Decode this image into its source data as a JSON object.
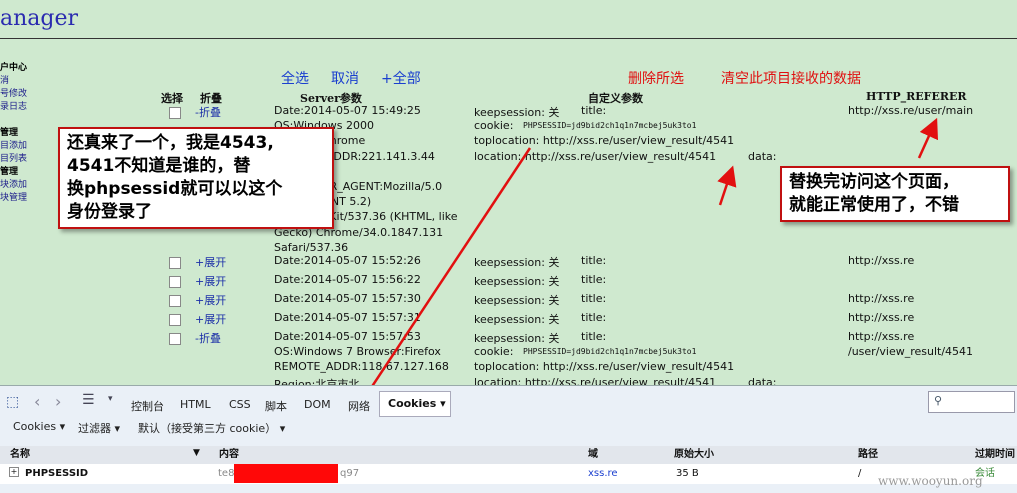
{
  "header": {
    "title": "anager"
  },
  "sidebar": {
    "items": [
      "户中心",
      "消",
      "号修改",
      "录日志",
      "管理",
      "目添加",
      "目列表",
      "管理",
      "块添加",
      "块管理"
    ]
  },
  "actions": {
    "select_all": "全选",
    "cancel": "取消",
    "plus_all": "+全部",
    "delete_selected": "删除所选",
    "clear_project": "清空此项目接收的数据"
  },
  "columns": {
    "select": "选择",
    "fold": "折叠",
    "server": "Server参数",
    "custom": "自定义参数",
    "referer": "HTTP_REFERER"
  },
  "rows": [
    {
      "fold": "-折叠",
      "server": [
        "Date:2014-05-07 15:49:25",
        "OS:Windows 2000",
        "Browser:Chrome",
        "REMOTE_ADDR:221.141.3.44",
        "",
        "HTTP_USER_AGENT:Mozilla/5.0",
        "(Windows NT 5.2)",
        "AppleWebKit/537.36 (KHTML, like",
        "Gecko) Chrome/34.0.1847.131",
        "Safari/537.36"
      ],
      "keepsession": "keepsession: 关",
      "title": "title:",
      "cookie_label": "cookie:",
      "cookie_value": "PHPSESSID=jd9bid2ch1q1n7mcbej5uk3to1",
      "toplocation": "toplocation: http://xss.re/user/view_result/4541",
      "location": "location: http://xss.re/user/view_result/4541",
      "data": "data:",
      "referer": "http://xss.re/user/main"
    },
    {
      "fold": "+展开",
      "server": [
        "Date:2014-05-07 15:52:26"
      ],
      "keepsession": "keepsession: 关",
      "title": "title:",
      "referer": "http://xss.re"
    },
    {
      "fold": "+展开",
      "server": [
        "Date:2014-05-07 15:56:22"
      ],
      "keepsession": "keepsession: 关",
      "title": "title:",
      "referer": ""
    },
    {
      "fold": "+展开",
      "server": [
        "Date:2014-05-07 15:57:30"
      ],
      "keepsession": "keepsession: 关",
      "title": "title:",
      "referer": "http://xss.re"
    },
    {
      "fold": "+展开",
      "server": [
        "Date:2014-05-07 15:57:31"
      ],
      "keepsession": "keepsession: 关",
      "title": "title:",
      "referer": "http://xss.re"
    },
    {
      "fold": "-折叠",
      "server": [
        "Date:2014-05-07 15:57:53",
        "OS:Windows 7    Browser:Firefox",
        "REMOTE_ADDR:118.67.127.168",
        "Region:北京市北..."
      ],
      "keepsession": "keepsession: 关",
      "title": "title:",
      "cookie_label": "cookie:",
      "cookie_value": "PHPSESSID=jd9bid2ch1q1n7mcbej5uk3to1",
      "toplocation": "toplocation: http://xss.re/user/view_result/4541",
      "location": "location: http://xss.re/user/view_result/4541",
      "data": "data:",
      "referer": "http://xss.re",
      "referer2": "/user/view_result/4541"
    }
  ],
  "callouts": {
    "left": [
      "还真来了一个，我是4543,",
      "4541不知道是谁的，替",
      "换phpsessid就可以以这个",
      "身份登录了"
    ],
    "right": [
      "替换完访问这个页面，",
      "就能正常使用了，不错"
    ]
  },
  "devtools": {
    "tabs": [
      "控制台",
      "HTML",
      "CSS",
      "脚本",
      "DOM",
      "网络"
    ],
    "active_tab": "Cookies",
    "sub": {
      "cookies": "Cookies",
      "filter": "过滤器",
      "default": "默认（接受第三方 cookie）"
    },
    "columns": [
      "名称",
      "内容",
      "域",
      "原始大小",
      "路径",
      "过期时间"
    ],
    "cookie_row": {
      "name": "PHPSESSID",
      "content_start": "te8",
      "content_end": "q97",
      "domain": "xss.re",
      "size": "35 B",
      "path": "/",
      "expires": "会话"
    }
  },
  "watermark": "www.wooyun.org",
  "colors": {
    "bg": "#cfe9cf",
    "accent_red": "#e01010",
    "link_blue": "#1b3fcf"
  }
}
